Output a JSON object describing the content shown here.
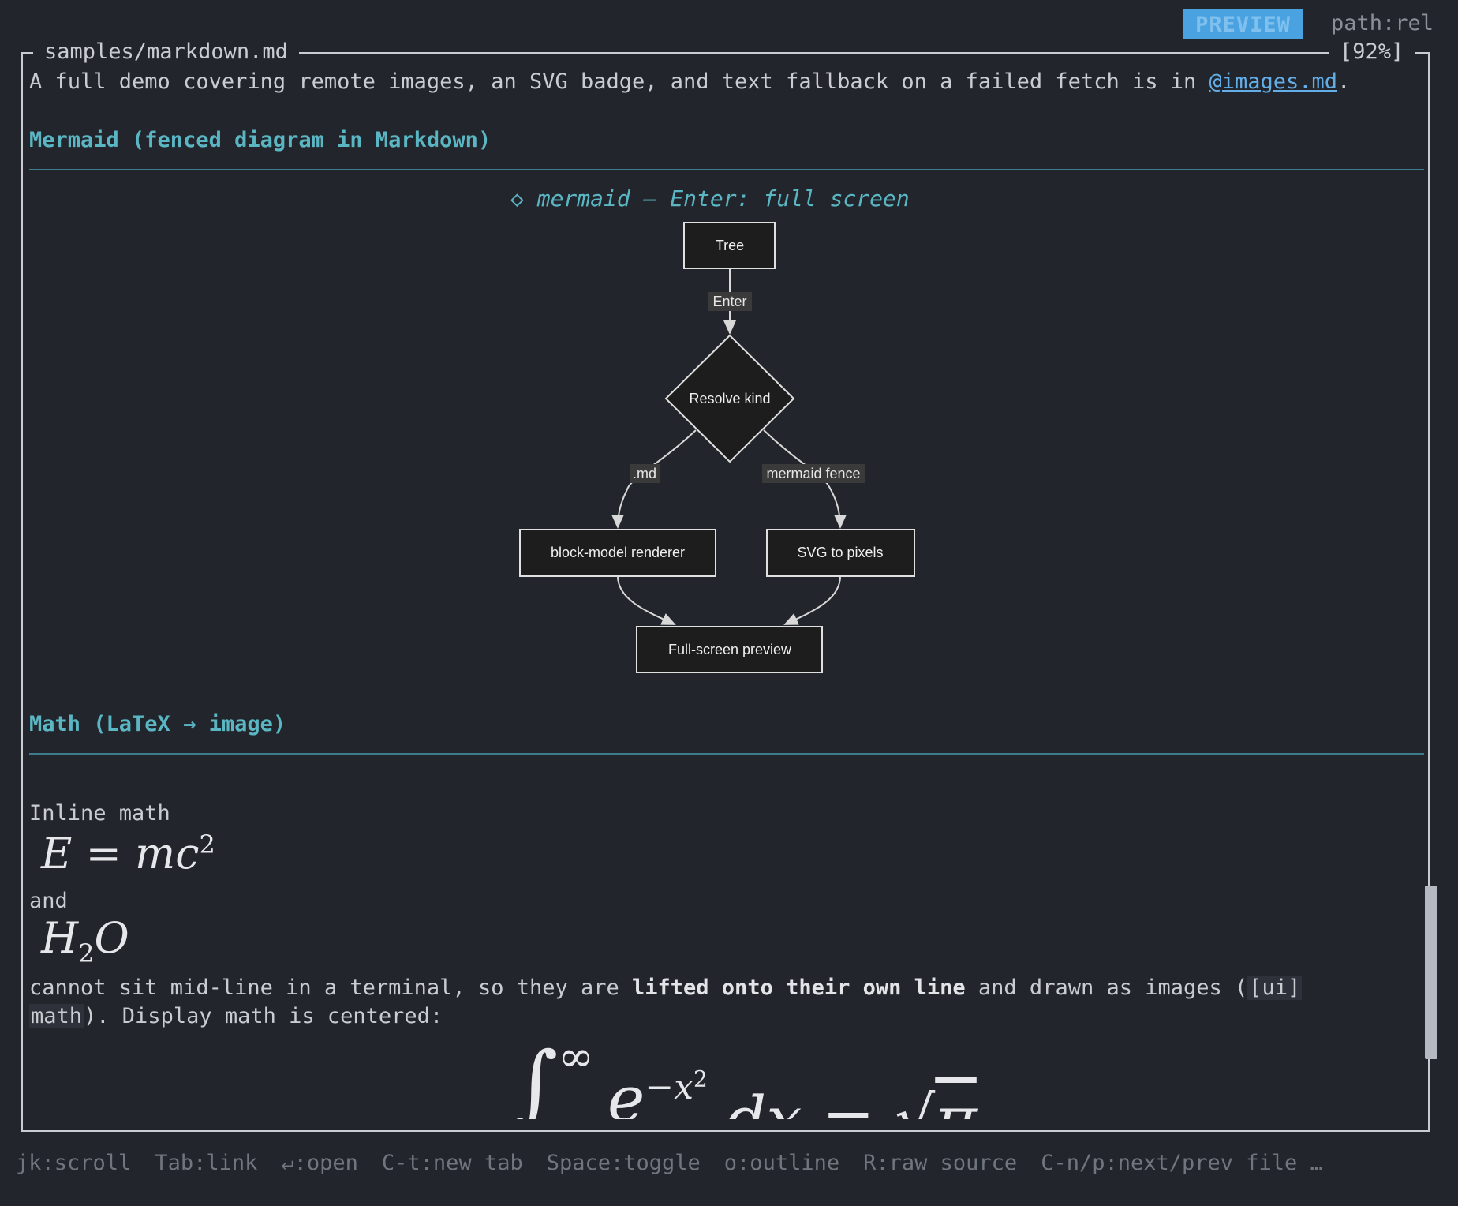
{
  "header": {
    "mode_badge": "PREVIEW",
    "path_mode": "path:rel"
  },
  "frame": {
    "title": "samples/markdown.md",
    "scroll_percent": "[92%]"
  },
  "intro": {
    "text_before": "A full demo covering remote images, an SVG badge, and text fallback on a failed fetch is in ",
    "link": "@images.md",
    "text_after": "."
  },
  "mermaid_section": {
    "heading": "Mermaid (fenced diagram in Markdown)",
    "caption_icon": "diamond-icon",
    "caption": "mermaid — Enter: full screen",
    "nodes": {
      "tree": "Tree",
      "resolve": "Resolve kind",
      "renderer": "block-model renderer",
      "svg": "SVG to pixels",
      "preview": "Full-screen preview"
    },
    "edges": {
      "enter": "Enter",
      "md": ".md",
      "fence": "mermaid fence"
    }
  },
  "math_section": {
    "heading": "Math (LaTeX → image)",
    "inline_label": "Inline math",
    "and_label": "and",
    "para_prefix": "cannot sit mid-line in a terminal, so they are ",
    "para_bold": "lifted onto their own line",
    "para_middle": " and drawn as images (",
    "para_code_a": "[ui]",
    "para_code_b": "math",
    "para_end": "). Display math is centered:"
  },
  "statusbar": {
    "items": [
      "jk:scroll",
      "Tab:link",
      "↵:open",
      "C-t:new tab",
      "Space:toggle",
      "o:outline",
      "R:raw source",
      "C-n/p:next/prev file …"
    ]
  },
  "colors": {
    "background": "#22252b",
    "accent": "#5bb6c4",
    "badge": "#4aa3e0",
    "link": "#64aee8"
  }
}
